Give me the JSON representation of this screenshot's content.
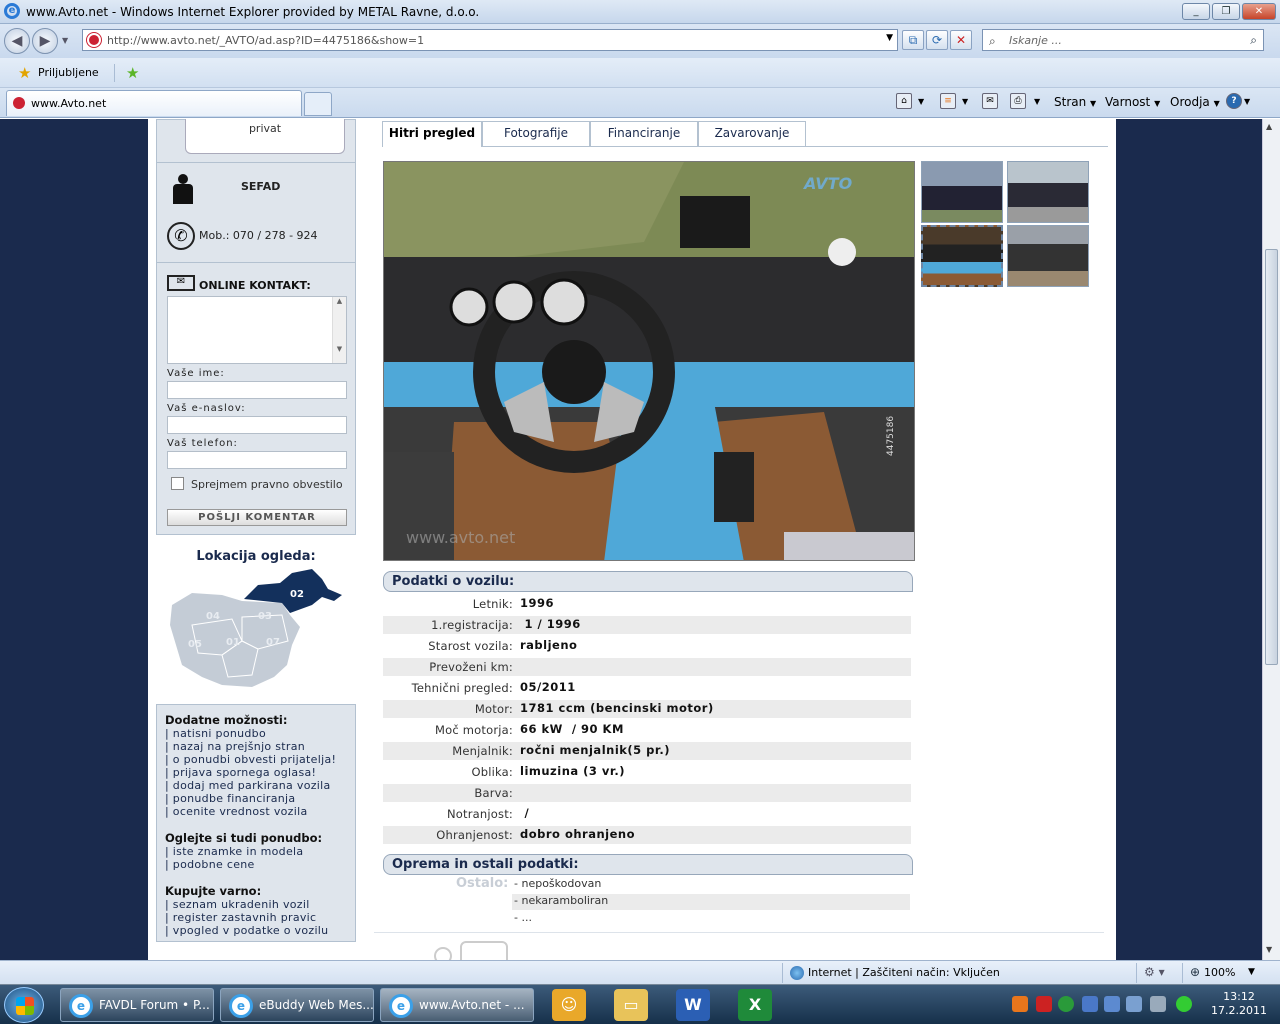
{
  "window": {
    "title": "www.Avto.net - Windows Internet Explorer provided by METAL Ravne, d.o.o."
  },
  "address": {
    "url": "http://www.avto.net/_AVTO/ad.asp?ID=4475186&show=1",
    "search_placeholder": "Iskanje ..."
  },
  "favorites": {
    "label": "Priljubljene"
  },
  "tab": {
    "title": "www.Avto.net"
  },
  "commandbar": {
    "page": "Stran",
    "safety": "Varnost",
    "tools": "Orodja"
  },
  "seller": {
    "type": "privat",
    "name": "SEFAD",
    "phone": "Mob.: 070 / 278 - 924"
  },
  "contact": {
    "title": "ONLINE KONTAKT:",
    "name_label": "Vaše ime:",
    "email_label": "Vaš e-naslov:",
    "phone_label": "Vaš telefon:",
    "terms_label": "Sprejmem pravno obvestilo",
    "submit": "POŠLJI KOMENTAR"
  },
  "location": {
    "title": "Lokacija ogleda:",
    "regions": [
      "02",
      "04",
      "03",
      "05",
      "01",
      "07"
    ]
  },
  "options": {
    "more_title": "Dodatne možnosti:",
    "more": [
      "| natisni ponudbo",
      "| nazaj na prejšnjo stran",
      "| o ponudbi obvesti prijatelja!",
      "| prijava spornega oglasa!",
      "| dodaj med parkirana vozila",
      "| ponudbe financiranja",
      "| ocenite vrednost vozila"
    ],
    "see_title": "Oglejte si tudi ponudbo:",
    "see": [
      "| iste znamke in modela",
      "| podobne cene"
    ],
    "buy_title": "Kupujte varno:",
    "buy": [
      "| seznam ukradenih vozil",
      "| register zastavnih pravic",
      "| vpogled v podatke o vozilu"
    ]
  },
  "tabs": [
    "Hitri pregled",
    "Fotografije",
    "Financiranje",
    "Zavarovanje"
  ],
  "vehicle": {
    "header": "Podatki o vozilu:",
    "rows": [
      {
        "k": "Letnik:",
        "v": "1996"
      },
      {
        "k": "1.registracija:",
        "v": " 1 / 1996"
      },
      {
        "k": "Starost vozila:",
        "v": "rabljeno"
      },
      {
        "k": "Prevoženi km:",
        "v": ""
      },
      {
        "k": "Tehnični pregled:",
        "v": "05/2011"
      },
      {
        "k": "Motor:",
        "v": "1781 ccm (bencinski motor)"
      },
      {
        "k": "Moč motorja:",
        "v": "66 kW  / 90 KM"
      },
      {
        "k": "Menjalnik:",
        "v": "ročni menjalnik(5 pr.)"
      },
      {
        "k": "Oblika:",
        "v": "limuzina (3 vr.)"
      },
      {
        "k": "Barva:",
        "v": ""
      },
      {
        "k": "Notranjost:",
        "v": " /"
      },
      {
        "k": "Ohranjenost:",
        "v": "dobro ohranjeno"
      }
    ]
  },
  "equipment": {
    "header": "Oprema in ostali podatki:",
    "ostalo": "Ostalo:",
    "items": [
      "- nepoškodovan",
      "- nekaramboliran",
      "- ..."
    ]
  },
  "photo": {
    "watermark": "www.avto.net",
    "side_id": "4475186",
    "logo": "AVTO"
  },
  "status": {
    "zone": "Internet | Zaščiteni način: Vključen",
    "zoom": "100%"
  },
  "taskbar": {
    "tasks": [
      "FAVDL Forum • P...",
      "eBuddy Web Mes...",
      "www.Avto.net - ..."
    ],
    "time": "13:12",
    "date": "17.2.2011"
  }
}
